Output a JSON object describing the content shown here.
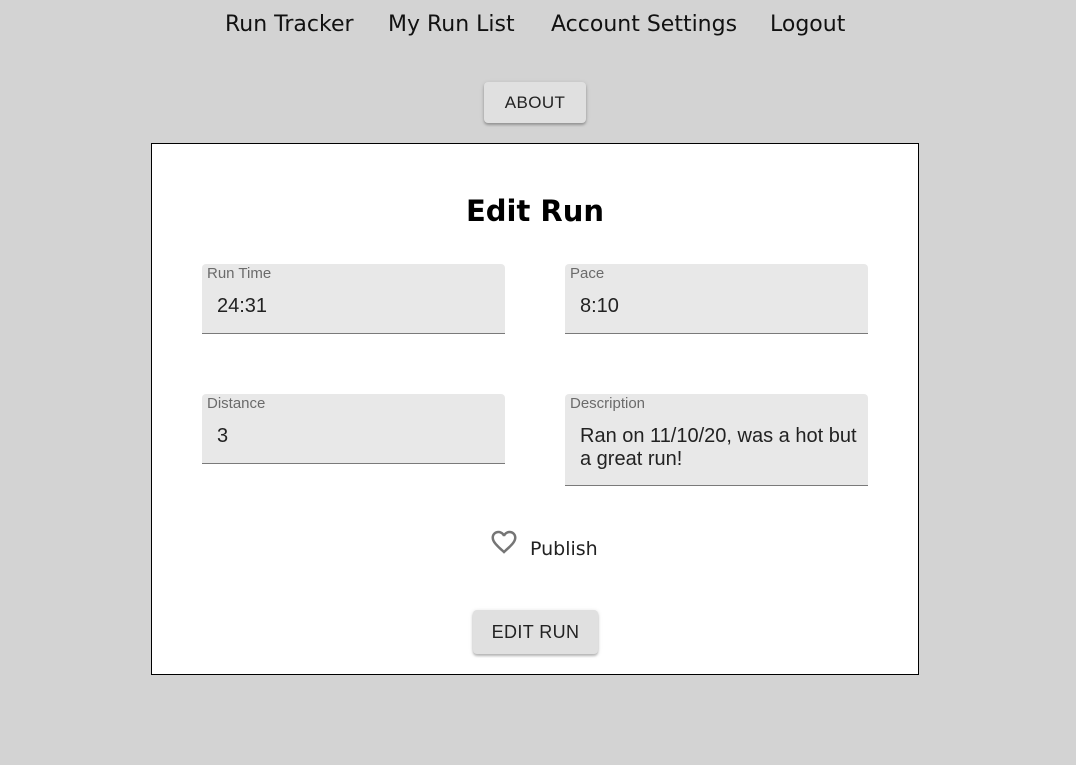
{
  "nav": {
    "items": [
      {
        "label": "Run Tracker"
      },
      {
        "label": "My Run List"
      },
      {
        "label": "Account Settings"
      },
      {
        "label": "Logout"
      }
    ]
  },
  "about_button": {
    "label": "ABOUT"
  },
  "form": {
    "title": "Edit Run",
    "fields": {
      "run_time": {
        "label": "Run Time",
        "value": "24:31"
      },
      "pace": {
        "label": "Pace",
        "value": "8:10"
      },
      "distance": {
        "label": "Distance",
        "value": "3"
      },
      "description": {
        "label": "Description",
        "value": "Ran on 11/10/20, was a hot but a great run!"
      }
    },
    "publish": {
      "label": "Publish",
      "icon": "heart-outline-icon",
      "checked": false
    },
    "submit_label": "EDIT RUN"
  },
  "colors": {
    "page_background": "#d3d3d3",
    "card_background": "#ffffff",
    "field_background": "#e8e8e8",
    "button_background": "#e0e0e0",
    "icon_color": "#757575"
  }
}
